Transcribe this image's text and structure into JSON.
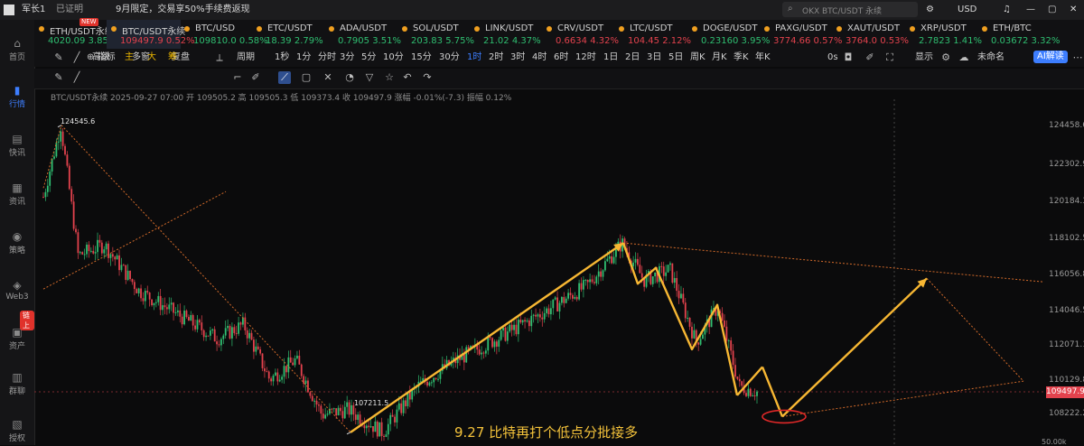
{
  "topbar": {
    "user": "军长1",
    "login_status": "已证明",
    "notice": "9月限定，交易享50%手续费返现",
    "search_placeholder": "OKX BTC/USDT 永续",
    "currency": "USD"
  },
  "sidebar": {
    "items": [
      {
        "label": "首页",
        "icon": "home-icon"
      },
      {
        "label": "行情",
        "icon": "chart-icon",
        "active": true
      },
      {
        "label": "快讯",
        "icon": "news-icon"
      },
      {
        "label": "资讯",
        "icon": "article-icon"
      },
      {
        "label": "策略",
        "icon": "robot-icon"
      },
      {
        "label": "Web3",
        "icon": "web3-icon"
      },
      {
        "label": "资产",
        "icon": "wallet-icon"
      },
      {
        "label": "群聊",
        "icon": "chat-icon"
      },
      {
        "label": "授权",
        "icon": "auth-icon"
      }
    ],
    "badge": "链上"
  },
  "tickers": [
    {
      "name": "ETH/USDT永续",
      "price": "4020.09",
      "change": "3.85%",
      "dir": "up"
    },
    {
      "name": "BTC/USDT永续",
      "price": "109497.9",
      "change": "0.52%",
      "dir": "dn",
      "selected": true
    },
    {
      "name": "BTC/USD",
      "price": "109810.0",
      "change": "0.58%",
      "dir": "up"
    },
    {
      "name": "ETC/USDT",
      "price": "18.39",
      "change": "2.79%",
      "dir": "up"
    },
    {
      "name": "ADA/USDT",
      "price": "0.7905",
      "change": "3.51%",
      "dir": "up"
    },
    {
      "name": "SOL/USDT",
      "price": "203.83",
      "change": "5.75%",
      "dir": "up"
    },
    {
      "name": "LINK/USDT",
      "price": "21.02",
      "change": "4.37%",
      "dir": "up"
    },
    {
      "name": "CRV/USDT",
      "price": "0.6634",
      "change": "4.32%",
      "dir": "dn"
    },
    {
      "name": "LTC/USDT",
      "price": "104.45",
      "change": "2.12%",
      "dir": "dn"
    },
    {
      "name": "DOGE/USDT",
      "price": "0.23160",
      "change": "3.95%",
      "dir": "up"
    },
    {
      "name": "PAXG/USDT",
      "price": "3774.66",
      "change": "0.57%",
      "dir": "dn"
    },
    {
      "name": "XAUT/USDT",
      "price": "3764.0",
      "change": "0.53%",
      "dir": "dn"
    },
    {
      "name": "XRP/USDT",
      "price": "2.7823",
      "change": "1.41%",
      "dir": "up"
    },
    {
      "name": "ETH/BTC",
      "price": "0.03672",
      "change": "3.32%",
      "dir": "up"
    }
  ],
  "new_badge": "NEW",
  "toolbar": {
    "indicator": "指标",
    "advanced": "高级",
    "multi_window": "多窗",
    "replay": "复盘",
    "main": "主",
    "big": "大",
    "chips": "筹",
    "period": "周期",
    "intervals": [
      "1秒",
      "1分",
      "分时",
      "3分",
      "5分",
      "10分",
      "15分",
      "30分",
      "1时",
      "2时",
      "3时",
      "4时",
      "6时",
      "12时",
      "1日",
      "2日",
      "3日",
      "5日",
      "周K",
      "月K",
      "季K",
      "年K"
    ],
    "active_interval": "1时",
    "seconds": "0s",
    "display": "显示",
    "unnamed": "未命名",
    "ai_button": "AI解读"
  },
  "info_line": "BTC/USDT永续 2025-09-27 07:00 开 109505.2 高 109505.3 低 109373.4 收 109497.9 涨幅 -0.01%(-7.3) 振幅 0.12%",
  "chart_data": {
    "type": "candlestick",
    "symbol": "BTC/USDT永续",
    "interval": "1时",
    "ylim": [
      107000,
      125500
    ],
    "y_ticks": [
      124458.6,
      122302.9,
      120184.3,
      118102.5,
      116056.8,
      114046.5,
      112071.1,
      110129.8,
      108222.2
    ],
    "last_price": 109497.9,
    "annotations": {
      "high": "124545.6",
      "low": "107211.5"
    },
    "approx_path": [
      {
        "t": 0,
        "p": 120500
      },
      {
        "t": 4,
        "p": 124545.6
      },
      {
        "t": 8,
        "p": 117200
      },
      {
        "t": 14,
        "p": 117800
      },
      {
        "t": 22,
        "p": 115200
      },
      {
        "t": 30,
        "p": 114000
      },
      {
        "t": 40,
        "p": 112500
      },
      {
        "t": 46,
        "p": 113300
      },
      {
        "t": 52,
        "p": 110200
      },
      {
        "t": 58,
        "p": 111300
      },
      {
        "t": 64,
        "p": 108200
      },
      {
        "t": 70,
        "p": 108500
      },
      {
        "t": 78,
        "p": 107211.5
      },
      {
        "t": 86,
        "p": 109800
      },
      {
        "t": 95,
        "p": 111300
      },
      {
        "t": 105,
        "p": 112600
      },
      {
        "t": 115,
        "p": 114000
      },
      {
        "t": 125,
        "p": 115500
      },
      {
        "t": 133,
        "p": 117900
      },
      {
        "t": 138,
        "p": 115800
      },
      {
        "t": 144,
        "p": 116400
      },
      {
        "t": 150,
        "p": 112300
      },
      {
        "t": 155,
        "p": 114300
      },
      {
        "t": 160,
        "p": 109800
      },
      {
        "t": 164,
        "p": 109497.9
      }
    ]
  },
  "caption": "9.27 比特再打个低点分批接多",
  "volume_label": "50.00k",
  "colors": {
    "up": "#2fbf71",
    "down": "#e3424d",
    "accent": "#3d7eff",
    "arrow": "#f7b733",
    "caption": "#f5c33b"
  }
}
